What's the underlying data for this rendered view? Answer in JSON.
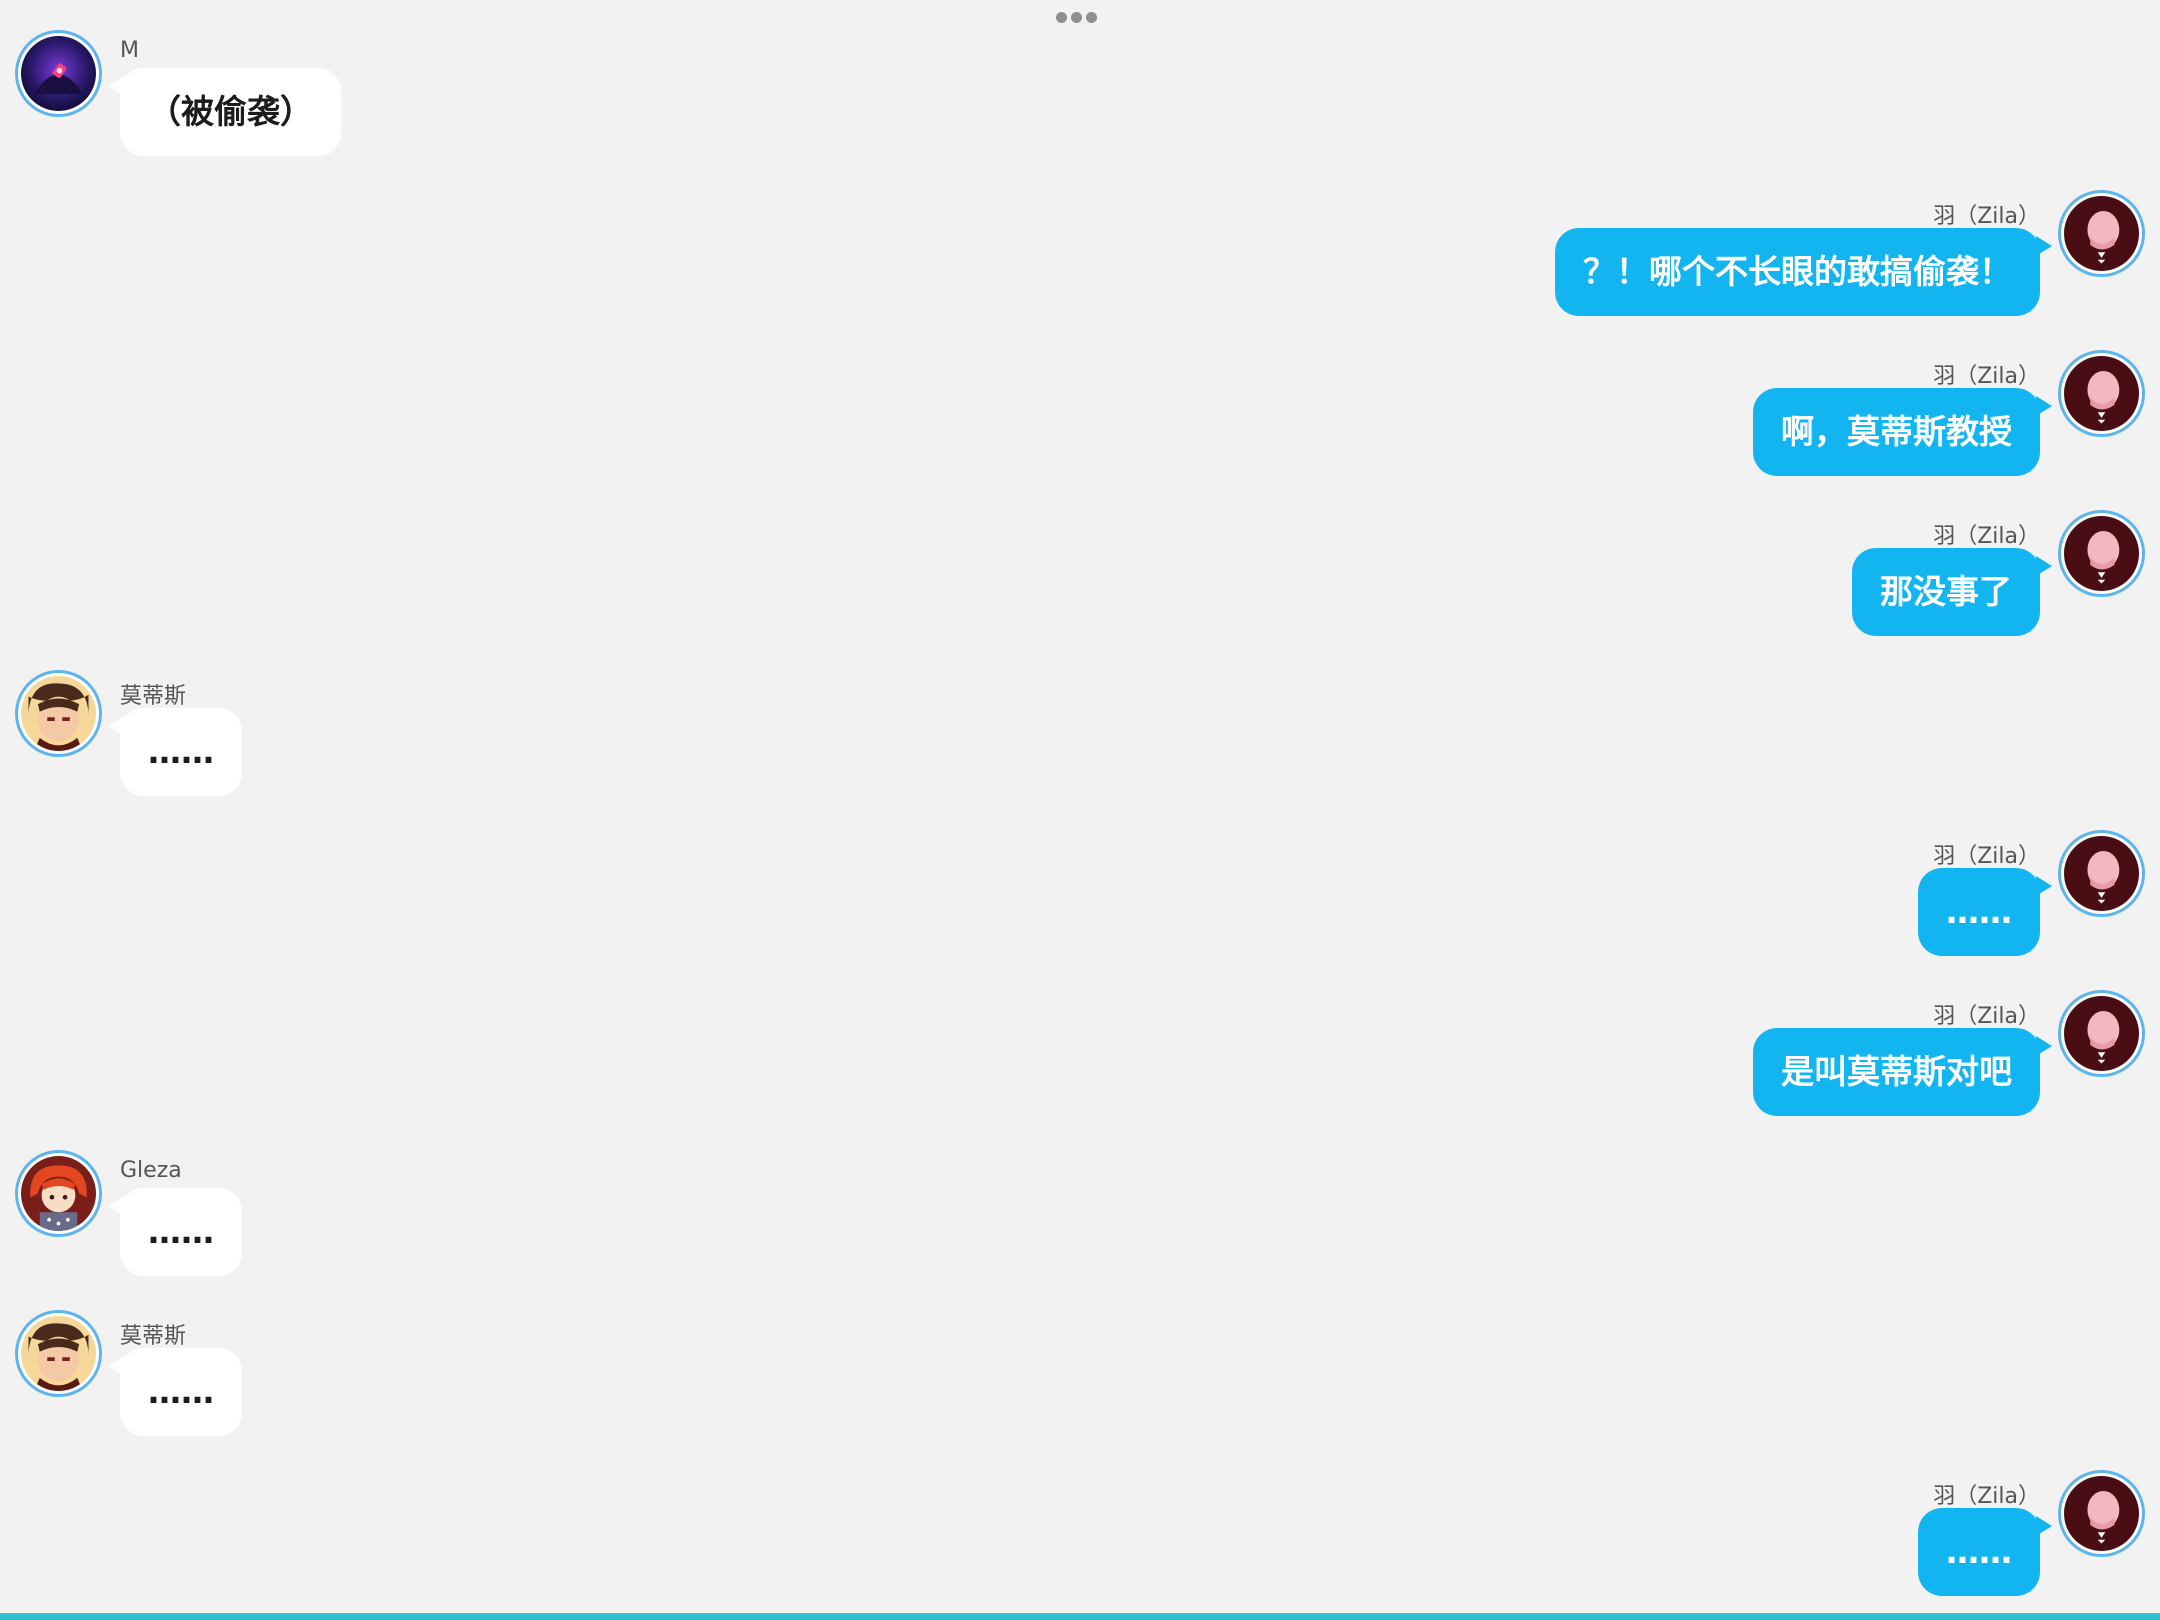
{
  "colors": {
    "background": "#f2f2f2",
    "own_bubble": "#13b5f1",
    "other_bubble": "#ffffff",
    "avatar_ring": "#5eb4ee",
    "bottom_bar": "#2ec0d0"
  },
  "header": {
    "menu_icon": "more-dots-icon"
  },
  "messages": [
    {
      "side": "left",
      "sender": "M",
      "text": "（被偷袭）",
      "avatar": "avatar-m"
    },
    {
      "side": "right",
      "sender": "羽（Zila）",
      "text": "？！哪个不长眼的敢搞偷袭！",
      "avatar": "avatar-zila"
    },
    {
      "side": "right",
      "sender": "羽（Zila）",
      "text": "啊，莫蒂斯教授",
      "avatar": "avatar-zila"
    },
    {
      "side": "right",
      "sender": "羽（Zila）",
      "text": "那没事了",
      "avatar": "avatar-zila"
    },
    {
      "side": "left",
      "sender": "莫蒂斯",
      "text": "……",
      "avatar": "avatar-modis"
    },
    {
      "side": "right",
      "sender": "羽（Zila）",
      "text": "……",
      "avatar": "avatar-zila"
    },
    {
      "side": "right",
      "sender": "羽（Zila）",
      "text": "是叫莫蒂斯对吧",
      "avatar": "avatar-zila"
    },
    {
      "side": "left",
      "sender": "Gleza",
      "text": "……",
      "avatar": "avatar-gleza"
    },
    {
      "side": "left",
      "sender": "莫蒂斯",
      "text": "……",
      "avatar": "avatar-modis"
    },
    {
      "side": "right",
      "sender": "羽（Zila）",
      "text": "……",
      "avatar": "avatar-zila"
    }
  ]
}
